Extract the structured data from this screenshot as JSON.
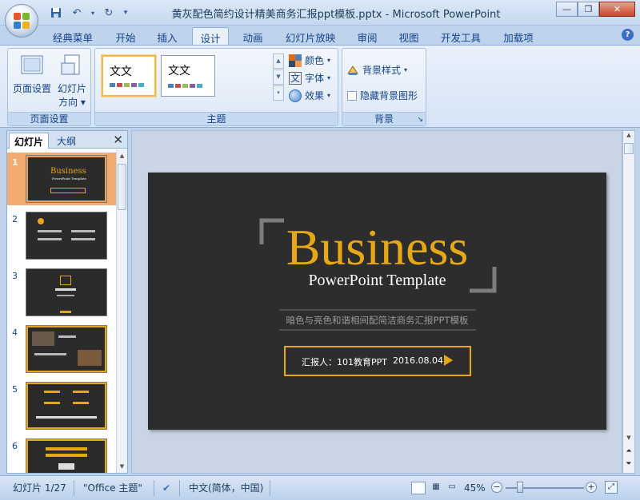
{
  "window": {
    "title": "黄灰配色简约设计精美商务汇报ppt模板.pptx - Microsoft PowerPoint",
    "min_icon": "minimize-icon",
    "max_icon": "restore-icon",
    "close_icon": "close-icon"
  },
  "tabs": [
    "经典菜单",
    "开始",
    "插入",
    "设计",
    "动画",
    "幻灯片放映",
    "审阅",
    "视图",
    "开发工具",
    "加载项"
  ],
  "active_tab": "设计",
  "ribbon": {
    "page_setup": {
      "setup_label": "页面设置",
      "orientation_label": "幻灯片",
      "orientation_label2": "方向",
      "group_label": "页面设置"
    },
    "themes": {
      "thumb_text": "文文",
      "colors_label": "颜色",
      "fonts_label": "字体",
      "effects_label": "效果",
      "group_label": "主题"
    },
    "background": {
      "styles_label": "背景样式",
      "hide_label": "隐藏背景图形",
      "group_label": "背景"
    }
  },
  "panel": {
    "tab_slides": "幻灯片",
    "tab_outline": "大纲",
    "slide_numbers": [
      "1",
      "2",
      "3",
      "4",
      "5",
      "6"
    ],
    "slide1_title": "Business",
    "slide1_sub": "PowerPoint Template"
  },
  "slide": {
    "title": "Business",
    "subtitle": "PowerPoint Template",
    "tagline": "暗色与亮色和谐相间配简洁商务汇报PPT模板",
    "reporter": "汇报人：101教育PPT",
    "date": "2016.08.04"
  },
  "status": {
    "slide_pos": "幻灯片 1/27",
    "theme": "\"Office 主题\"",
    "language": "中文(简体，中国)",
    "zoom": "45%"
  },
  "colors": {
    "accent_gold": "#e6a817",
    "slide_bg": "#2d2d2d"
  }
}
